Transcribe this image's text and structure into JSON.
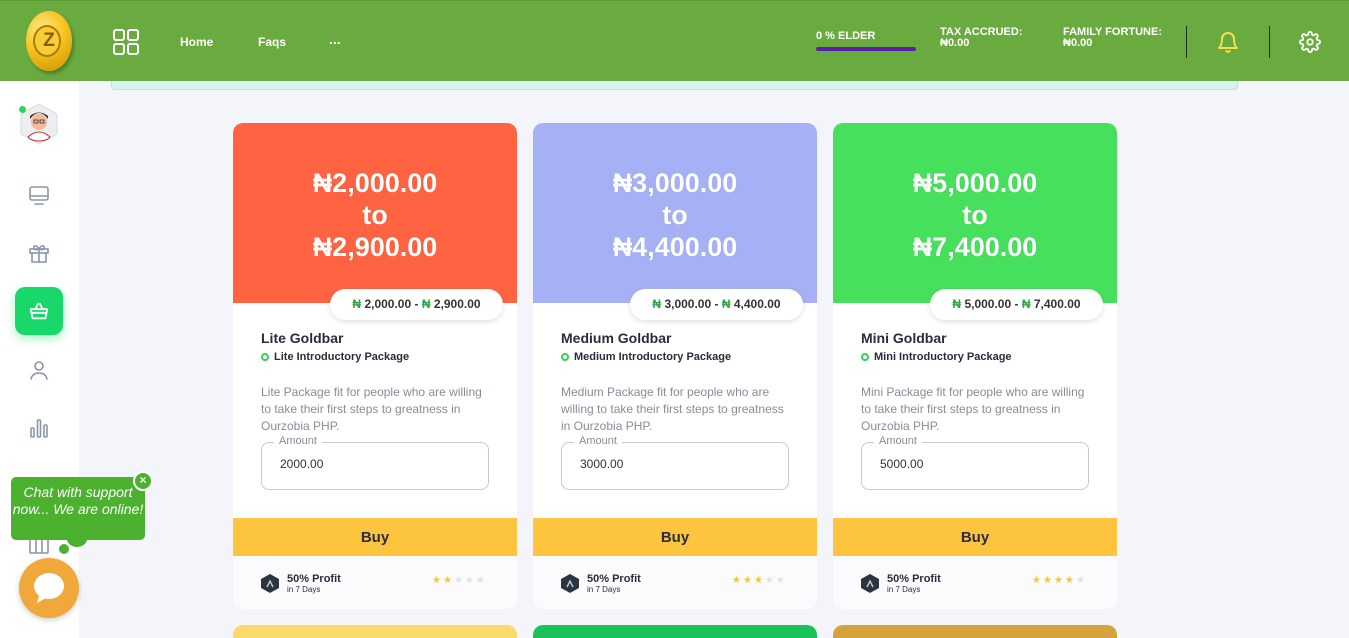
{
  "header": {
    "logo_letter": "Z",
    "nav": {
      "home": "Home",
      "faqs": "Faqs",
      "more": "..."
    },
    "elder_label": "0 % ELDER",
    "tax_label": "TAX ACCRUED:",
    "tax_value": "₦0.00",
    "family_label": "FAMILY FORTUNE:",
    "family_value": "₦0.00",
    "icons": [
      "apps-grid-icon",
      "bell-icon",
      "gear-icon"
    ],
    "accent_color": "#69ab3e"
  },
  "sidebar": {
    "items": [
      "dashboard-icon",
      "gift-icon",
      "basket-icon",
      "user-icon",
      "chart-icon",
      "box-icon"
    ],
    "active": "basket-icon",
    "active_color": "#18d86a"
  },
  "cards": [
    {
      "color": "#ff6341",
      "price_from": "₦2,000.00",
      "price_to_word": "to",
      "price_to": "₦2,900.00",
      "range_from": "2,000.00",
      "range_to": "2,900.00",
      "currency": "₦",
      "title": "Lite Goldbar",
      "subtitle": "Lite Introductory Package",
      "description": "Lite Package fit for people who are willing to take their first steps to greatness in Ourzobia PHP.",
      "amount_label": "Amount",
      "amount_value": "2000.00",
      "buy_label": "Buy",
      "profit": "50% Profit",
      "duration": "in 7 Days",
      "stars_filled": 2,
      "stars_total": 5
    },
    {
      "color": "#a6b1f5",
      "price_from": "₦3,000.00",
      "price_to_word": "to",
      "price_to": "₦4,400.00",
      "range_from": "3,000.00",
      "range_to": "4,400.00",
      "currency": "₦",
      "title": "Medium Goldbar",
      "subtitle": "Medium Introductory Package",
      "description": "Medium Package fit for people who are willing to take their first steps to greatness in Ourzobia PHP.",
      "amount_label": "Amount",
      "amount_value": "3000.00",
      "buy_label": "Buy",
      "profit": "50% Profit",
      "duration": "in 7 Days",
      "stars_filled": 3,
      "stars_total": 5
    },
    {
      "color": "#47e05d",
      "price_from": "₦5,000.00",
      "price_to_word": "to",
      "price_to": "₦7,400.00",
      "range_from": "5,000.00",
      "range_to": "7,400.00",
      "currency": "₦",
      "title": "Mini Goldbar",
      "subtitle": "Mini Introductory Package",
      "description": "Mini Package fit for people who are willing to take their first steps to greatness in Ourzobia PHP.",
      "amount_label": "Amount",
      "amount_value": "5000.00",
      "buy_label": "Buy",
      "profit": "50% Profit",
      "duration": "in 7 Days",
      "stars_filled": 4,
      "stars_total": 5
    }
  ],
  "next_row_colors": [
    "#fbd96a",
    "#19c35a",
    "#d4a43a"
  ],
  "chat": {
    "message": "Chat with support now... We are online!",
    "close": "×",
    "button_color": "#f0a83a"
  }
}
